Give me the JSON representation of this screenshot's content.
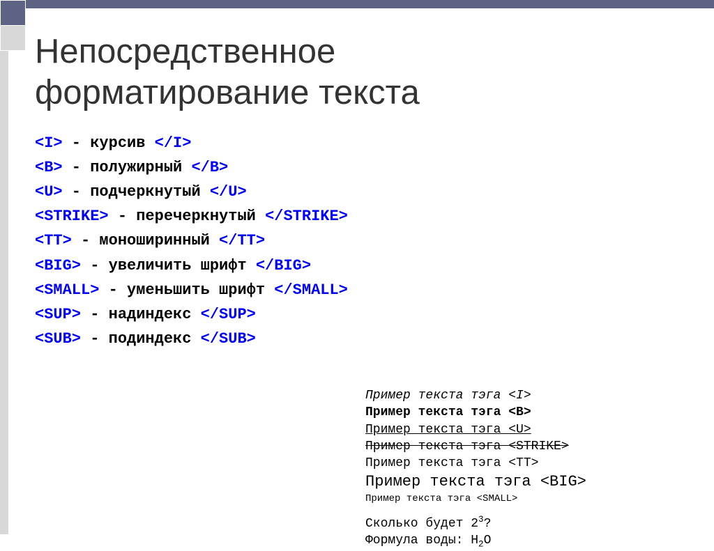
{
  "title_line1": "Непосредственное",
  "title_line2": "форматирование текста",
  "tags": [
    {
      "open": "<I>",
      "desc": " - курсив ",
      "close": "</I>"
    },
    {
      "open": "<B>",
      "desc": " - полужирный ",
      "close": "</B>"
    },
    {
      "open": "<U>",
      "desc": " - подчеркнутый ",
      "close": "</U>"
    },
    {
      "open": "<STRIKE>",
      "desc": " - перечеркнутый ",
      "close": "</STRIKE>"
    },
    {
      "open": "<TT>",
      "desc": " - моноширинный ",
      "close": "</TT>"
    },
    {
      "open": "<BIG>",
      "desc": " - увеличить шрифт ",
      "close": "</BIG>"
    },
    {
      "open": "<SMALL>",
      "desc": " - уменьшить шрифт ",
      "close": "</SMALL>"
    },
    {
      "open": "<SUP>",
      "desc": " - надиндекс ",
      "close": "</SUP>"
    },
    {
      "open": "<SUB>",
      "desc": " - подиндекс ",
      "close": "</SUB>"
    }
  ],
  "examples": [
    {
      "text": "Пример текста тэга ",
      "tag": "<I>"
    },
    {
      "text": "Пример текста тэга ",
      "tag": "<B>"
    },
    {
      "text": "Пример текста тэга ",
      "tag": "<U>"
    },
    {
      "text": "Пример текста тэга ",
      "tag": "<STRIKE>"
    },
    {
      "text": "Пример текста тэга ",
      "tag": "<TT>"
    },
    {
      "text": "Пример текста тэга ",
      "tag": "<BIG>"
    },
    {
      "text": "Пример текста тэга ",
      "tag": "<SMALL>"
    }
  ],
  "q1_before": "Сколько будет 2",
  "q1_sup": "3",
  "q1_after": "?",
  "q2_before": "Формула воды: H",
  "q2_sub": "2",
  "q2_after": "O"
}
